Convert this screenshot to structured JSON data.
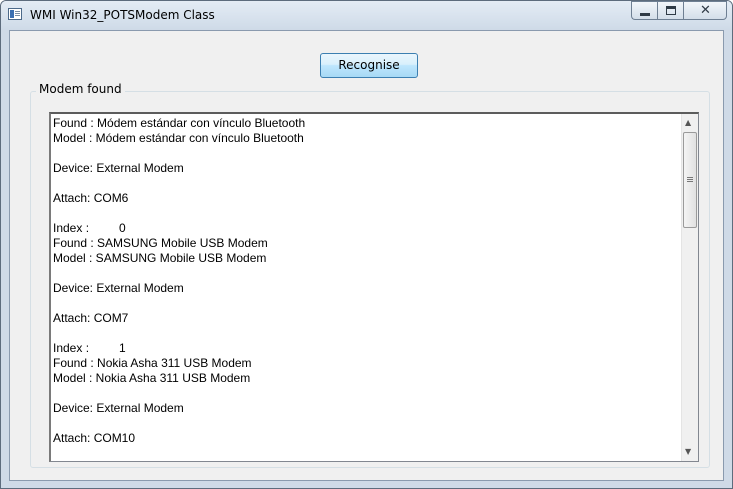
{
  "window": {
    "title": "WMI Win32_POTSModem Class",
    "buttons": {
      "minimize_icon": "minimize-icon",
      "maximize_icon": "maximize-icon",
      "close_icon": "close-icon"
    }
  },
  "toolbar": {
    "recognise_label": "Recognise"
  },
  "group": {
    "label": "Modem found"
  },
  "output": {
    "text": "Found : Módem estándar con vínculo Bluetooth\nModel : Módem estándar con vínculo Bluetooth\n\nDevice: External Modem\n\nAttach: COM6\n\nIndex :         0\nFound : SAMSUNG Mobile USB Modem\nModel : SAMSUNG Mobile USB Modem\n\nDevice: External Modem\n\nAttach: COM7\n\nIndex :         1\nFound : Nokia Asha 311 USB Modem\nModel : Nokia Asha 311 USB Modem\n\nDevice: External Modem\n\nAttach: COM10"
  }
}
